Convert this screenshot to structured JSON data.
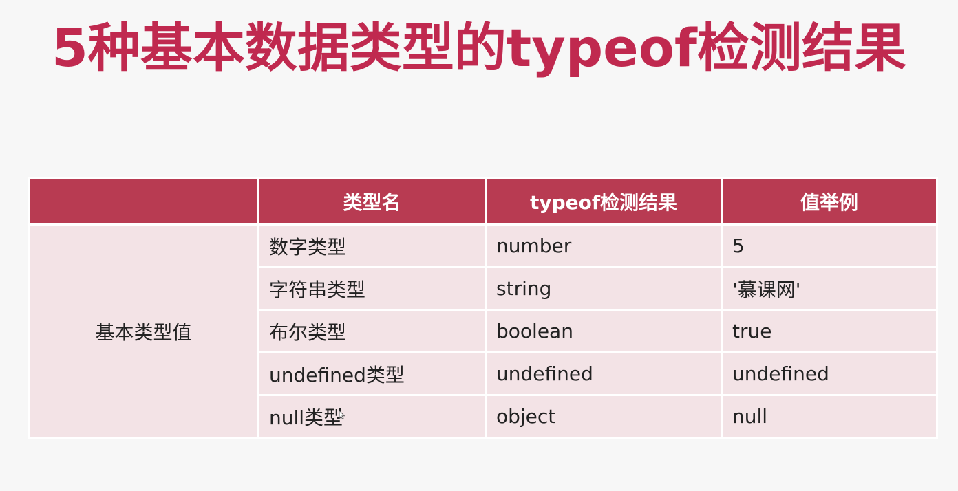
{
  "title": "5种基本数据类型的typeof检测结果",
  "table": {
    "headers": [
      "",
      "类型名",
      "typeof检测结果",
      "值举例"
    ],
    "category": "基本类型值",
    "rows": [
      {
        "type_name": "数字类型",
        "typeof_result": "number",
        "example": "5"
      },
      {
        "type_name": "字符串类型",
        "typeof_result": "string",
        "example": "'慕课网'"
      },
      {
        "type_name": "布尔类型",
        "typeof_result": "boolean",
        "example": "true"
      },
      {
        "type_name": "undefined类型",
        "typeof_result": "undefined",
        "example": "undefined"
      },
      {
        "type_name": "null类型",
        "typeof_result": "object",
        "example": "null"
      }
    ]
  },
  "colors": {
    "title": "#c0294f",
    "header_bg": "#b83b52",
    "cell_bg": "#f3e3e6"
  },
  "icons": {
    "cursor": "mouse-cursor-icon"
  }
}
